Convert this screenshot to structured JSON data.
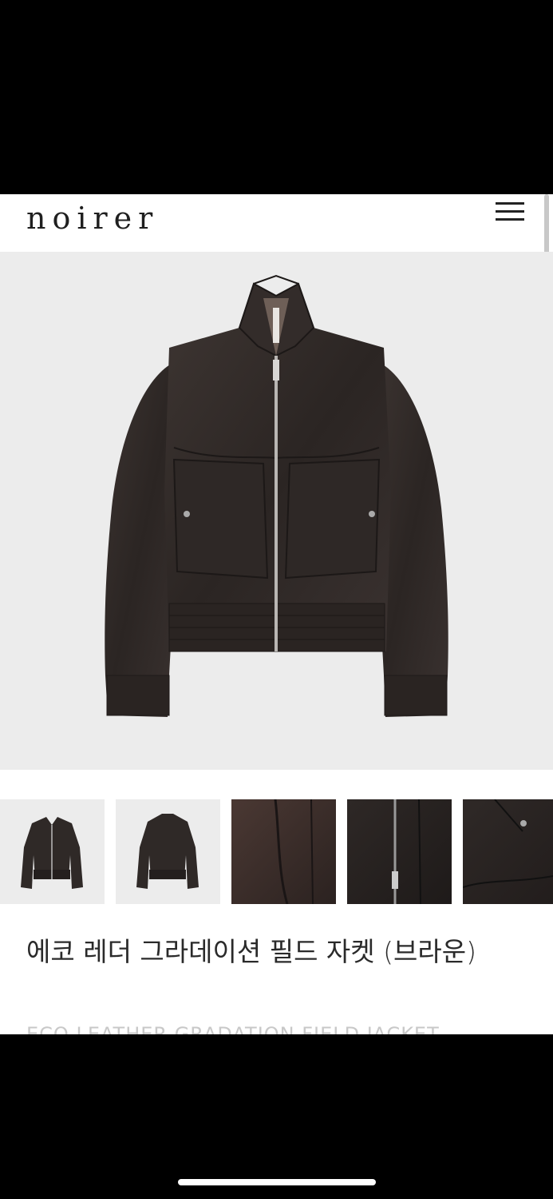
{
  "header": {
    "brand": "noirer",
    "menu_icon": "hamburger-menu-icon"
  },
  "product": {
    "name": "에코 레더 그라데이션 필드 자켓 (브라운)",
    "subtitle": "ECO LEATHER GRADATION FIELD JACKET"
  },
  "gallery": {
    "thumbnails": [
      "front-view",
      "back-view",
      "lining-detail",
      "zipper-detail",
      "pocket-detail"
    ]
  },
  "colors": {
    "leather": "#2f2927",
    "background": "#ececec",
    "accent_text": "#2a2a2a"
  }
}
